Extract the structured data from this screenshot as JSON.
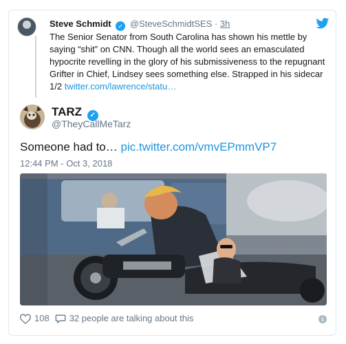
{
  "parent_tweet": {
    "author_name": "Steve Schmidt",
    "handle": "@SteveSchmidtSES",
    "separator": "·",
    "time_ago": "3h",
    "text": "The Senior Senator from South Carolina has shown his mettle by saying “shit” on CNN. Though all the world sees an emasculated hypocrite revelling in the glory of his submissiveness to the repugnant Grifter in Chief,  Lindsey sees something else. Strapped in his sidecar 1/2 ",
    "link_text": "twitter.com/lawrence/statu…"
  },
  "main_tweet": {
    "author_name": "TARZ",
    "handle": "@TheyCallMeTarz",
    "text": "Someone had to… ",
    "link_text": "pic.twitter.com/vmvEPmmVP7",
    "timestamp": "12:44 PM - Oct 3, 2018"
  },
  "footer": {
    "likes": "108",
    "talking": "32 people are talking about this"
  },
  "icons": {
    "verified": "verified-badge-icon",
    "brand": "twitter-bird-icon",
    "like": "heart-icon",
    "reply": "speech-bubble-icon",
    "info": "info-icon"
  },
  "colors": {
    "link": "#1b95e0",
    "verified": "#1da1f2",
    "muted": "#657786",
    "text": "#14171a",
    "border": "#e1e8ed"
  }
}
